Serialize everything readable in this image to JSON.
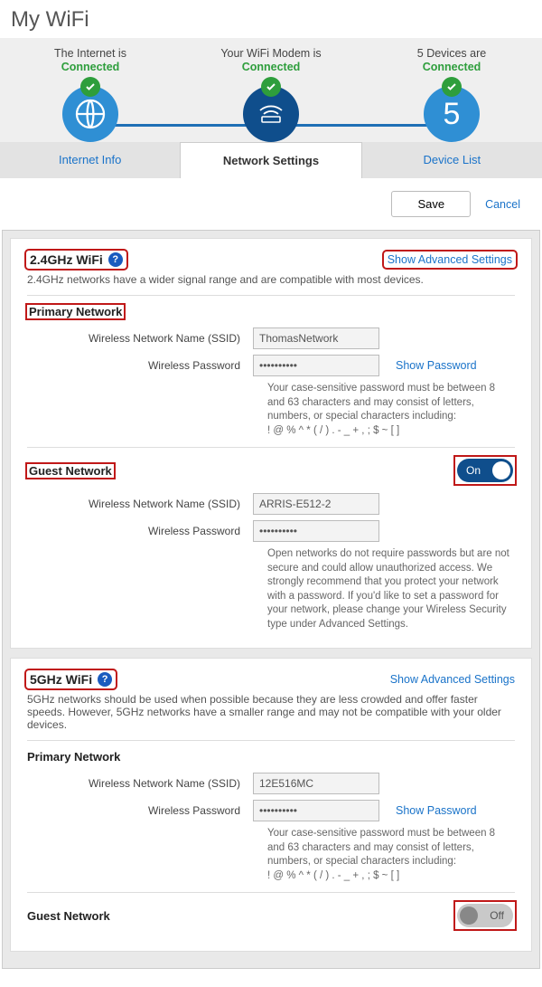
{
  "page_title": "My WiFi",
  "status": {
    "internet": {
      "line1": "The Internet is",
      "state": "Connected"
    },
    "modem": {
      "line1": "Your WiFi Modem is",
      "state": "Connected"
    },
    "devices": {
      "line1_prefix": "5",
      "line1_suffix": "  Devices are",
      "state": "Connected",
      "count": "5"
    }
  },
  "tabs": {
    "internet": "Internet Info",
    "network": "Network Settings",
    "devices": "Device List"
  },
  "actions": {
    "save": "Save",
    "cancel": "Cancel"
  },
  "band24": {
    "title": "2.4GHz WiFi",
    "adv_link": "Show Advanced Settings",
    "desc": "2.4GHz networks have a wider signal range and are compatible with most devices.",
    "primary_title": "Primary Network",
    "ssid_label": "Wireless Network Name (SSID)",
    "ssid_value": "ThomasNetwork",
    "pwd_label": "Wireless Password",
    "pwd_value": "••••••••••",
    "show_pwd": "Show Password",
    "pwd_hint": "Your case-sensitive password must be between 8 and 63 characters and may consist of letters, numbers, or special characters including:\n! @ % ^ * ( / ) . - _ + , ; $ ~ [ ]",
    "guest_title": "Guest Network",
    "guest_toggle": "On",
    "guest_ssid": "ARRIS-E512-2",
    "guest_pwd": "••••••••••",
    "guest_hint": "Open networks do not require passwords but are not secure and could allow unauthorized access. We strongly recommend that you protect your network with a password. If you'd like to set a password for your network, please change your Wireless Security type under Advanced Settings."
  },
  "band5": {
    "title": "5GHz WiFi",
    "adv_link": "Show Advanced Settings",
    "desc": "5GHz networks should be used when possible because they are less crowded and offer faster speeds. However, 5GHz networks have a smaller range and may not be compatible with your older devices.",
    "primary_title": "Primary Network",
    "ssid_label": "Wireless Network Name (SSID)",
    "ssid_value": "12E516MC",
    "pwd_label": "Wireless Password",
    "pwd_value": "••••••••••",
    "show_pwd": "Show Password",
    "pwd_hint": "Your case-sensitive password must be between 8 and 63 characters and may consist of letters, numbers, or special characters including:\n! @ % ^ * ( / ) . - _ + , ; $ ~ [ ]",
    "guest_title": "Guest Network",
    "guest_toggle": "Off"
  }
}
